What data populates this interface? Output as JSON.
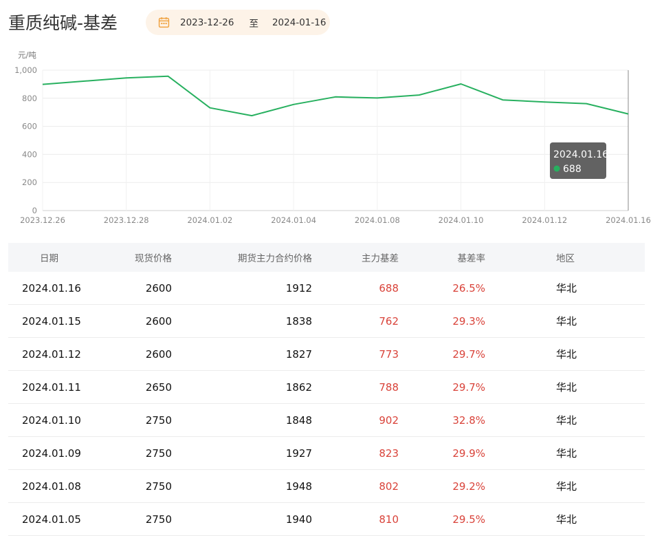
{
  "header": {
    "title": "重质纯碱-基差",
    "date_from": "2023-12-26",
    "date_sep": "至",
    "date_to": "2024-01-16"
  },
  "chart_data": {
    "type": "line",
    "ylabel": "元/吨",
    "ylim": [
      0,
      1000
    ],
    "yticks": [
      "0",
      "200",
      "400",
      "600",
      "800",
      "1,000"
    ],
    "x_tick_labels": [
      "2023.12.26",
      "2023.12.28",
      "2024.01.02",
      "2024.01.04",
      "2024.01.08",
      "2024.01.10",
      "2024.01.12",
      "2024.01.16"
    ],
    "x": [
      "2023.12.26",
      "2023.12.27",
      "2023.12.28",
      "2023.12.29",
      "2024.01.02",
      "2024.01.03",
      "2024.01.04",
      "2024.01.05",
      "2024.01.08",
      "2024.01.09",
      "2024.01.10",
      "2024.01.11",
      "2024.01.12",
      "2024.01.15",
      "2024.01.16"
    ],
    "series": [
      {
        "values": [
          899,
          922,
          945,
          957,
          732,
          676,
          756,
          810,
          802,
          823,
          902,
          788,
          773,
          762,
          688
        ],
        "color": "#27b05f"
      }
    ],
    "grid": true,
    "tooltip": {
      "date": "2024.01.16",
      "value": "688"
    }
  },
  "table": {
    "headers": [
      "日期",
      "现货价格",
      "期货主力合约价格",
      "主力基差",
      "基差率",
      "地区"
    ],
    "rows": [
      [
        "2024.01.16",
        "2600",
        "1912",
        "688",
        "26.5%",
        "华北"
      ],
      [
        "2024.01.15",
        "2600",
        "1838",
        "762",
        "29.3%",
        "华北"
      ],
      [
        "2024.01.12",
        "2600",
        "1827",
        "773",
        "29.7%",
        "华北"
      ],
      [
        "2024.01.11",
        "2650",
        "1862",
        "788",
        "29.7%",
        "华北"
      ],
      [
        "2024.01.10",
        "2750",
        "1848",
        "902",
        "32.8%",
        "华北"
      ],
      [
        "2024.01.09",
        "2750",
        "1927",
        "823",
        "29.9%",
        "华北"
      ],
      [
        "2024.01.08",
        "2750",
        "1948",
        "802",
        "29.2%",
        "华北"
      ],
      [
        "2024.01.05",
        "2750",
        "1940",
        "810",
        "29.5%",
        "华北"
      ]
    ]
  },
  "colors": {
    "accent": "#f0a342",
    "line": "#27b05f",
    "negative_red": "#d9433a"
  }
}
